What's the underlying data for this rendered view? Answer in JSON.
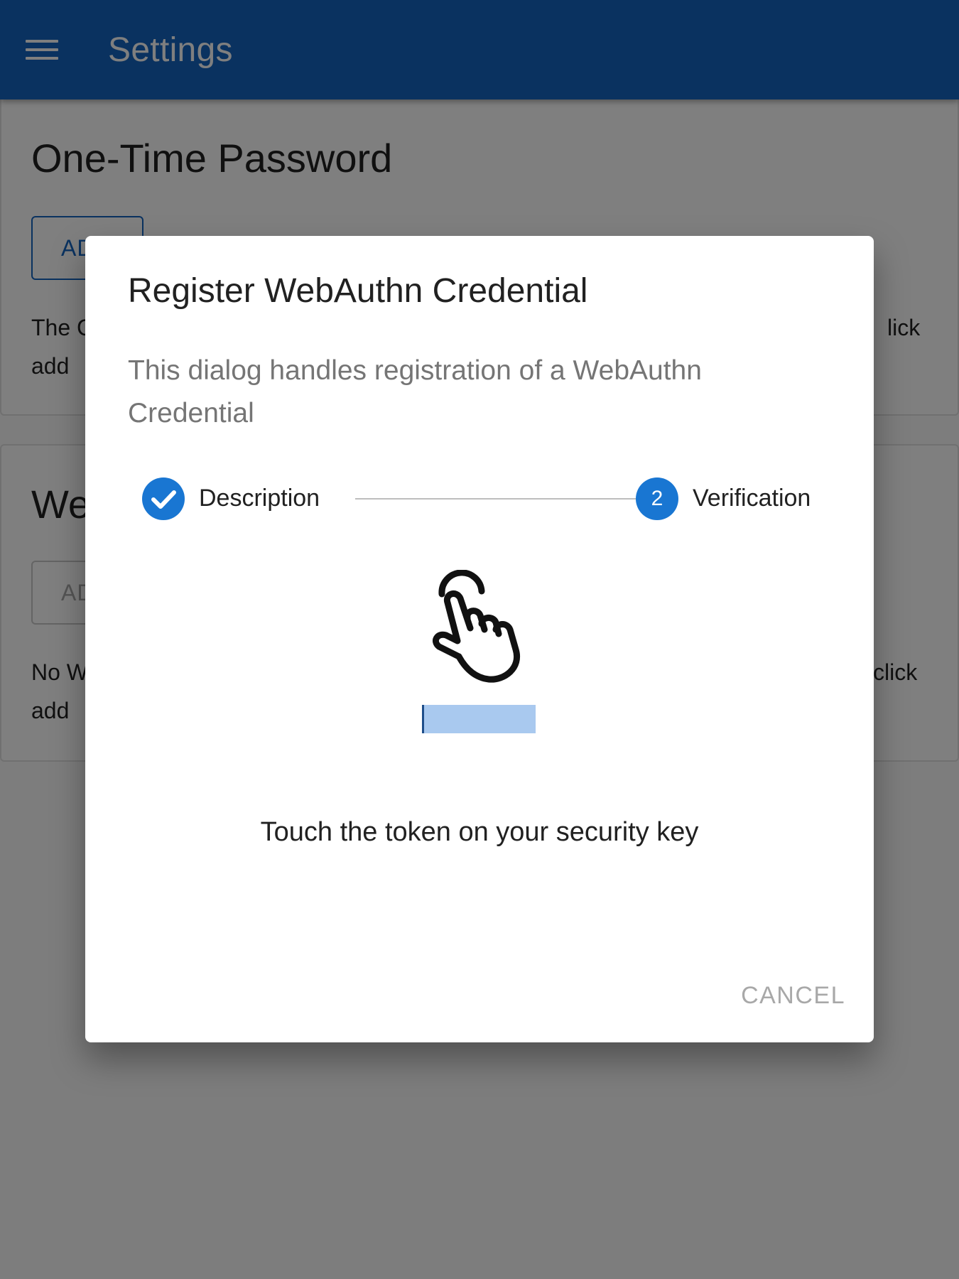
{
  "app_bar": {
    "title": "Settings",
    "menu_icon": "menu-icon"
  },
  "otp_card": {
    "title": "One-Time Password",
    "add_button_label": "AD",
    "description_start": "The C",
    "description_end": "lick",
    "description_line2": "add"
  },
  "webauthn_card": {
    "title": "We",
    "add_button_label": "AD",
    "description_start": "No W",
    "description_end": "click",
    "description_line2": "add"
  },
  "dialog": {
    "title": "Register WebAuthn Credential",
    "text": "This dialog handles registration of a WebAuthn Credential",
    "steps": [
      {
        "label": "Description",
        "status": "completed",
        "icon": "check-icon"
      },
      {
        "label": "Verification",
        "status": "active",
        "number": "2"
      }
    ],
    "touch_icon": "touch-hand-icon",
    "instruction": "Touch the token on your security key",
    "cancel_label": "CANCEL"
  },
  "colors": {
    "primary": "#1565c0",
    "step_active": "#1976d2",
    "overlay": "rgba(0,0,0,0.5)"
  }
}
